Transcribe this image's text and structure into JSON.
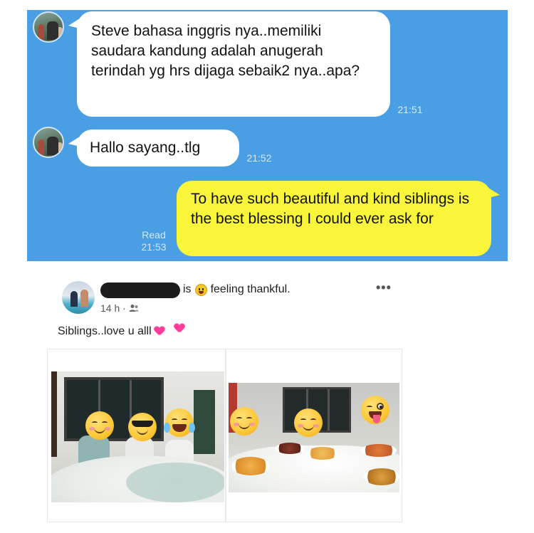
{
  "chat": {
    "background": "#4a9ee3",
    "messages": [
      {
        "direction": "incoming",
        "text": "Steve bahasa inggris nya..memiliki saudara kandung adalah anugerah terindah yg hrs dijaga sebaik2 nya..apa?",
        "time": "21:51"
      },
      {
        "direction": "incoming",
        "text": "Hallo sayang..tlg",
        "time": "21:52"
      },
      {
        "direction": "outgoing",
        "text": "To have such beautiful and kind siblings is the best blessing I could ever ask for",
        "status": "Read",
        "time": "21:53",
        "bubble_color": "#f8f53b"
      }
    ]
  },
  "post": {
    "is_text": "is",
    "feeling_emoji": "smile-emoji-icon",
    "feeling_text": "feeling thankful.",
    "time": "14 h ·",
    "audience_icon": "friends-icon",
    "more_label": "•••",
    "body": "Siblings..love u alll",
    "body_emojis": [
      "two-hearts-icon",
      "two-hearts-icon"
    ],
    "photos": [
      {
        "faces": [
          "smiling-face-with-blush-icon",
          "sunglasses-face-icon",
          "tears-of-joy-face-icon"
        ]
      },
      {
        "faces": [
          "smiling-face-with-blush-icon",
          "smiling-face-with-blush-icon",
          "winking-tongue-face-icon"
        ]
      }
    ]
  }
}
